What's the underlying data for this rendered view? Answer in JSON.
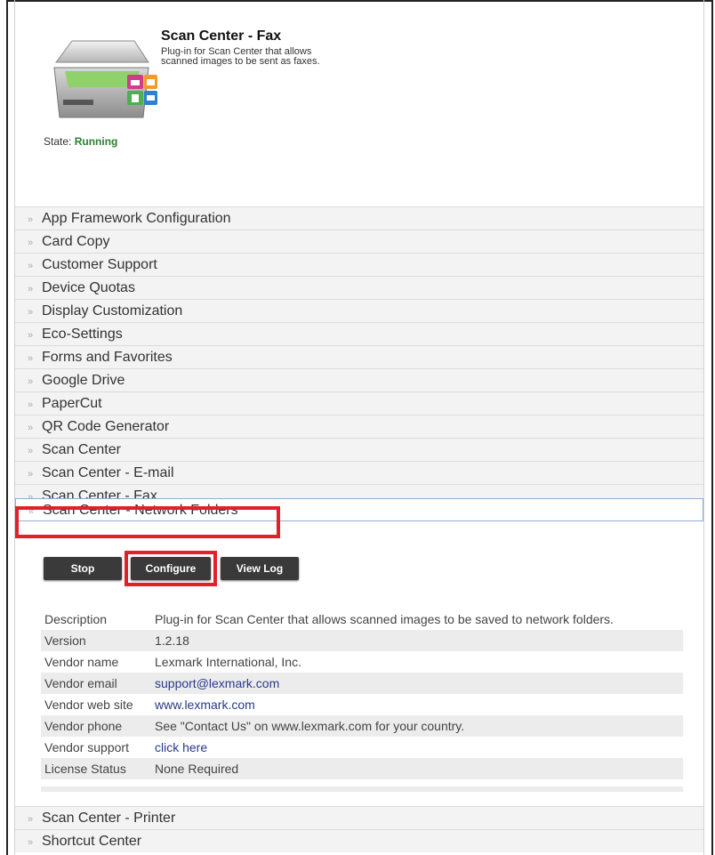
{
  "app": {
    "title": "Scan Center - Fax",
    "description": "Plug-in for Scan Center that allows scanned images to be sent as faxes.",
    "state_label": "State:",
    "state_value": "Running"
  },
  "accordion": [
    "App Framework Configuration",
    "Card Copy",
    "Customer Support",
    "Device Quotas",
    "Display Customization",
    "Eco-Settings",
    "Forms and Favorites",
    "Google Drive",
    "PaperCut",
    "QR Code Generator",
    "Scan Center",
    "Scan Center - E-mail",
    "Scan Center - Fax"
  ],
  "expanded": {
    "title": "Scan Center - Network Folders",
    "buttons": {
      "stop": "Stop",
      "configure": "Configure",
      "view_log": "View Log"
    },
    "details": [
      {
        "key": "Description",
        "value": "Plug-in for Scan Center that allows scanned images to be saved to network folders."
      },
      {
        "key": "Version",
        "value": "1.2.18"
      },
      {
        "key": "Vendor name",
        "value": "Lexmark International, Inc."
      },
      {
        "key": "Vendor email",
        "value": "support@lexmark.com",
        "link": true
      },
      {
        "key": "Vendor web site",
        "value": "www.lexmark.com",
        "link": true
      },
      {
        "key": "Vendor phone",
        "value": "See \"Contact Us\" on www.lexmark.com for your country."
      },
      {
        "key": "Vendor support",
        "value": "click here",
        "link": true
      },
      {
        "key": "License Status",
        "value": "None Required"
      }
    ]
  },
  "after": [
    "Scan Center - Printer",
    "Shortcut Center"
  ],
  "colors": {
    "highlight": "#e0202a",
    "running": "#2e7d32",
    "link": "#2a3a8a",
    "button": "#3a3a3a"
  }
}
